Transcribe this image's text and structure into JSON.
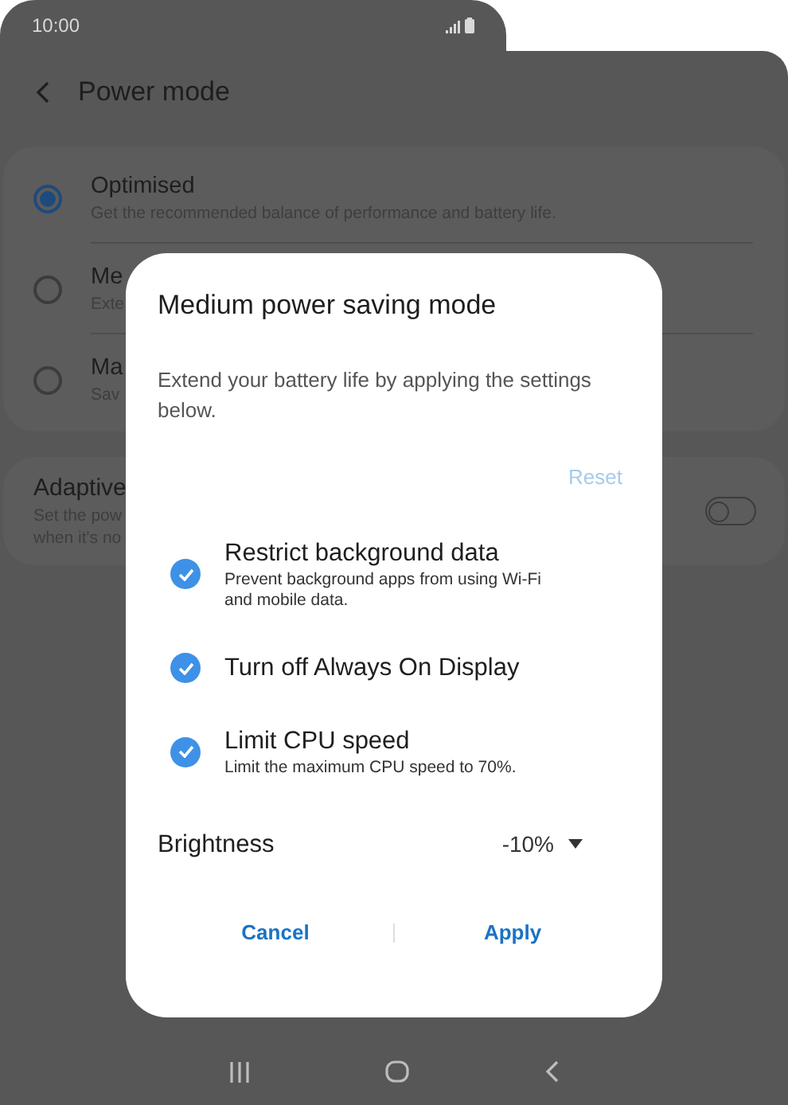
{
  "status_bar": {
    "time": "10:00"
  },
  "header": {
    "title": "Power mode"
  },
  "power_modes": [
    {
      "title": "Optimised",
      "subtitle": "Get the recommended balance of performance and battery life.",
      "selected": true
    },
    {
      "title": "Me",
      "subtitle": "Exte",
      "selected": false
    },
    {
      "title": "Ma",
      "subtitle": "Sav",
      "selected": false
    }
  ],
  "adaptive": {
    "title": "Adaptive",
    "description": [
      "Set the pow",
      "when it's no"
    ],
    "on": false
  },
  "dialog": {
    "title": "Medium power saving mode",
    "description": "Extend your battery life by applying the settings below.",
    "reset": {
      "label": "Reset",
      "disabled": true
    },
    "options": [
      {
        "title": "Restrict background data",
        "subtitle": "Prevent background apps from using Wi-Fi and mobile data.",
        "checked": true
      },
      {
        "title": "Turn off Always On Display",
        "checked": true
      },
      {
        "title": "Limit CPU speed",
        "subtitle": "Limit the maximum CPU speed to 70%.",
        "checked": true
      }
    ],
    "brightness": {
      "label": "Brightness",
      "value": "-10%"
    },
    "buttons": [
      "Cancel",
      "Apply"
    ]
  }
}
